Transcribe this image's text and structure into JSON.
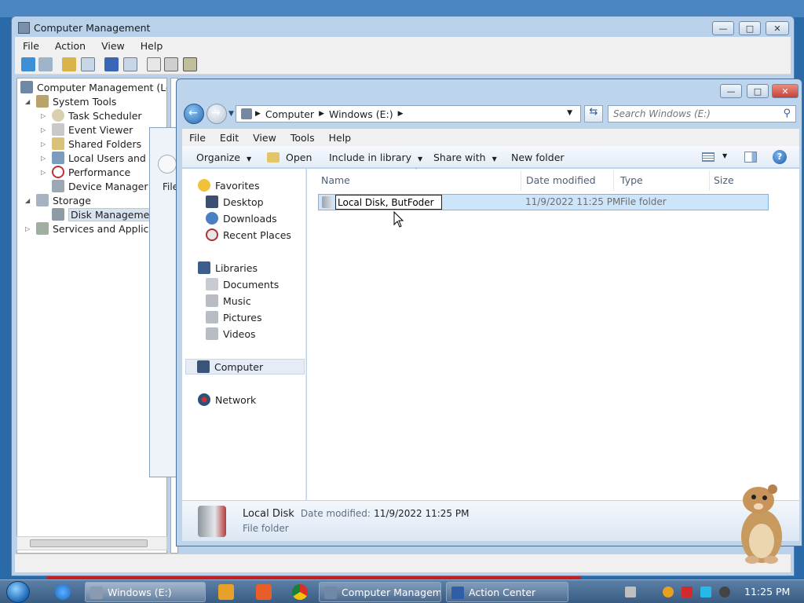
{
  "computer_management": {
    "title": "Computer Management",
    "menu": [
      "File",
      "Action",
      "View",
      "Help"
    ],
    "tree": [
      {
        "label": "Computer Management (Local",
        "level": 0,
        "expanded": true
      },
      {
        "label": "System Tools",
        "level": 1,
        "expanded": true
      },
      {
        "label": "Task Scheduler",
        "level": 2
      },
      {
        "label": "Event Viewer",
        "level": 2
      },
      {
        "label": "Shared Folders",
        "level": 2
      },
      {
        "label": "Local Users and Gro",
        "level": 2
      },
      {
        "label": "Performance",
        "level": 2
      },
      {
        "label": "Device Manager",
        "level": 2
      },
      {
        "label": "Storage",
        "level": 1,
        "expanded": true
      },
      {
        "label": "Disk Management",
        "level": 2,
        "selected": true
      },
      {
        "label": "Services and Application",
        "level": 1
      }
    ],
    "background_dialog_menu": "File"
  },
  "explorer": {
    "address": {
      "parts": [
        "Computer",
        "Windows (E:)"
      ]
    },
    "search_placeholder": "Search Windows (E:)",
    "menu": [
      "File",
      "Edit",
      "View",
      "Tools",
      "Help"
    ],
    "commands": {
      "organize": "Organize",
      "open": "Open",
      "include": "Include in library",
      "share": "Share with",
      "new_folder": "New folder"
    },
    "nav": {
      "favorites": "Favorites",
      "desktop": "Desktop",
      "downloads": "Downloads",
      "recent": "Recent Places",
      "libraries": "Libraries",
      "documents": "Documents",
      "music": "Music",
      "pictures": "Pictures",
      "videos": "Videos",
      "computer": "Computer",
      "network": "Network"
    },
    "columns": {
      "name": "Name",
      "date": "Date modified",
      "type": "Type",
      "size": "Size"
    },
    "file": {
      "rename_value": "Local Disk, ButFoder",
      "date": "11/9/2022 11:25 PM",
      "type": "File folder"
    },
    "details": {
      "name": "Local Disk",
      "date_label": "Date modified:",
      "date_value": "11/9/2022 11:25 PM",
      "type": "File folder"
    }
  },
  "taskbar": {
    "buttons": {
      "explorer": "Windows (E:)",
      "compmgmt": "Computer Managem...",
      "action_center": "Action Center"
    },
    "clock": "11:25 PM"
  },
  "colors": {
    "accent": "#3a78c4",
    "selection": "#cce5fb",
    "close": "#c9423a"
  }
}
